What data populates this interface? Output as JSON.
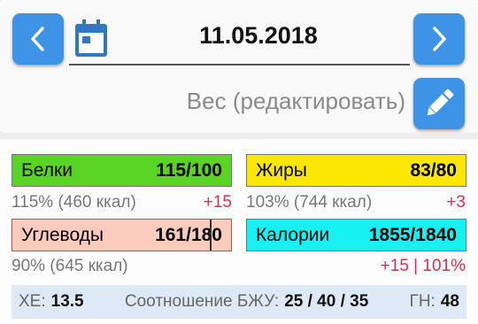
{
  "date": {
    "value": "11.05.2018",
    "prev_icon": "chevron-left-icon",
    "next_icon": "chevron-right-icon",
    "calendar_icon": "calendar-icon"
  },
  "weight": {
    "label": "Вес (редактировать)",
    "edit_icon": "pencil-icon"
  },
  "macros": {
    "protein": {
      "label": "Белки",
      "value": "115/100",
      "percent_text": "115% (460 ккал)",
      "delta": "+15",
      "color": "#5ad424"
    },
    "fat": {
      "label": "Жиры",
      "value": "83/80",
      "percent_text": "103% (744 ккал)",
      "delta": "+3",
      "color": "#fbe600"
    },
    "carbs": {
      "label": "Углеводы",
      "value": "161/180",
      "percent_text": "90% (645 ккал)",
      "fill_fraction": 0.9,
      "color": "#fbcbbd"
    },
    "calories": {
      "label": "Калории",
      "value": "1855/1840",
      "delta": "+15 | 101%",
      "color": "#17f0f0"
    }
  },
  "summary": {
    "xe_label": "ХЕ:",
    "xe_value": "13.5",
    "ratio_label": "Соотношение БЖУ:",
    "ratio_value": "25 / 40 / 35",
    "gn_label": "ГН:",
    "gn_value": "48"
  },
  "colors": {
    "accent": "#3d94e6",
    "delta": "#e02a4e",
    "summary_bg": "#dde9f5"
  }
}
